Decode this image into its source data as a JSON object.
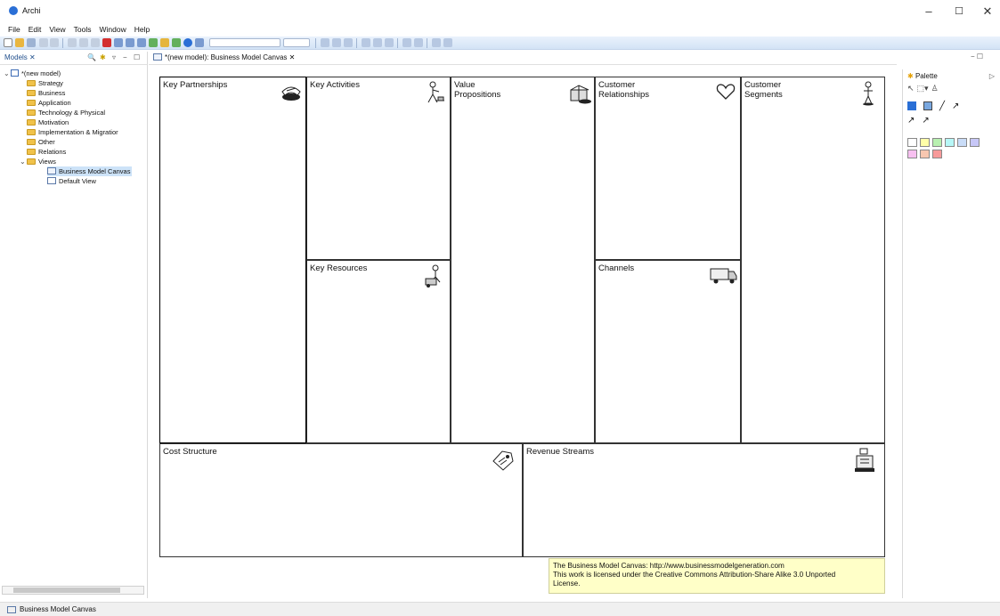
{
  "app": {
    "title": "Archi"
  },
  "window_controls": {
    "minimize": "–",
    "maximize": "☐",
    "close": "✕"
  },
  "menu": [
    "File",
    "Edit",
    "View",
    "Tools",
    "Window",
    "Help"
  ],
  "models_panel": {
    "tab_label": "Models",
    "tree": [
      {
        "label": "*(new model)",
        "level": 0,
        "type": "model"
      },
      {
        "label": "Strategy",
        "level": 1,
        "type": "folder"
      },
      {
        "label": "Business",
        "level": 1,
        "type": "folder"
      },
      {
        "label": "Application",
        "level": 1,
        "type": "folder"
      },
      {
        "label": "Technology & Physical",
        "level": 1,
        "type": "folder"
      },
      {
        "label": "Motivation",
        "level": 1,
        "type": "folder"
      },
      {
        "label": "Implementation & Migratior",
        "level": 1,
        "type": "folder"
      },
      {
        "label": "Other",
        "level": 1,
        "type": "folder"
      },
      {
        "label": "Relations",
        "level": 1,
        "type": "folder"
      },
      {
        "label": "Views",
        "level": 1,
        "type": "folder"
      },
      {
        "label": "Business Model Canvas",
        "level": 2,
        "type": "view",
        "selected": true
      },
      {
        "label": "Default View",
        "level": 2,
        "type": "view"
      }
    ]
  },
  "editor": {
    "tab_label": "*(new model): Business Model Canvas"
  },
  "canvas": {
    "key_partnerships": "Key Partnerships",
    "key_activities": "Key Activities",
    "key_resources": "Key Resources",
    "value_propositions": "Value\nPropositions",
    "customer_relationships": "Customer\nRelationships",
    "channels": "Channels",
    "customer_segments": "Customer\nSegments",
    "cost_structure": "Cost Structure",
    "revenue_streams": "Revenue Streams"
  },
  "license_note": {
    "line1": "The Business Model Canvas: http://www.businessmodelgeneration.com",
    "line2": "This work is licensed under the Creative Commons Attribution-Share Alike 3.0 Unported",
    "line3": "License."
  },
  "palette": {
    "title": "Palette",
    "swatches_row1": [
      "#ffffff",
      "#ffffa8",
      "#b8f0b0",
      "#b7f7f7",
      "#c9dcf7",
      "#c7c7f7"
    ],
    "swatches_row2": [
      "#f7c0f0",
      "#f7c7b0",
      "#f79a9a"
    ]
  },
  "status": {
    "text": "Business Model Canvas"
  },
  "colors": {
    "toolbar": "#d3e3f6",
    "selection": "#cde3f8",
    "license_bg": "#ffffc8"
  }
}
